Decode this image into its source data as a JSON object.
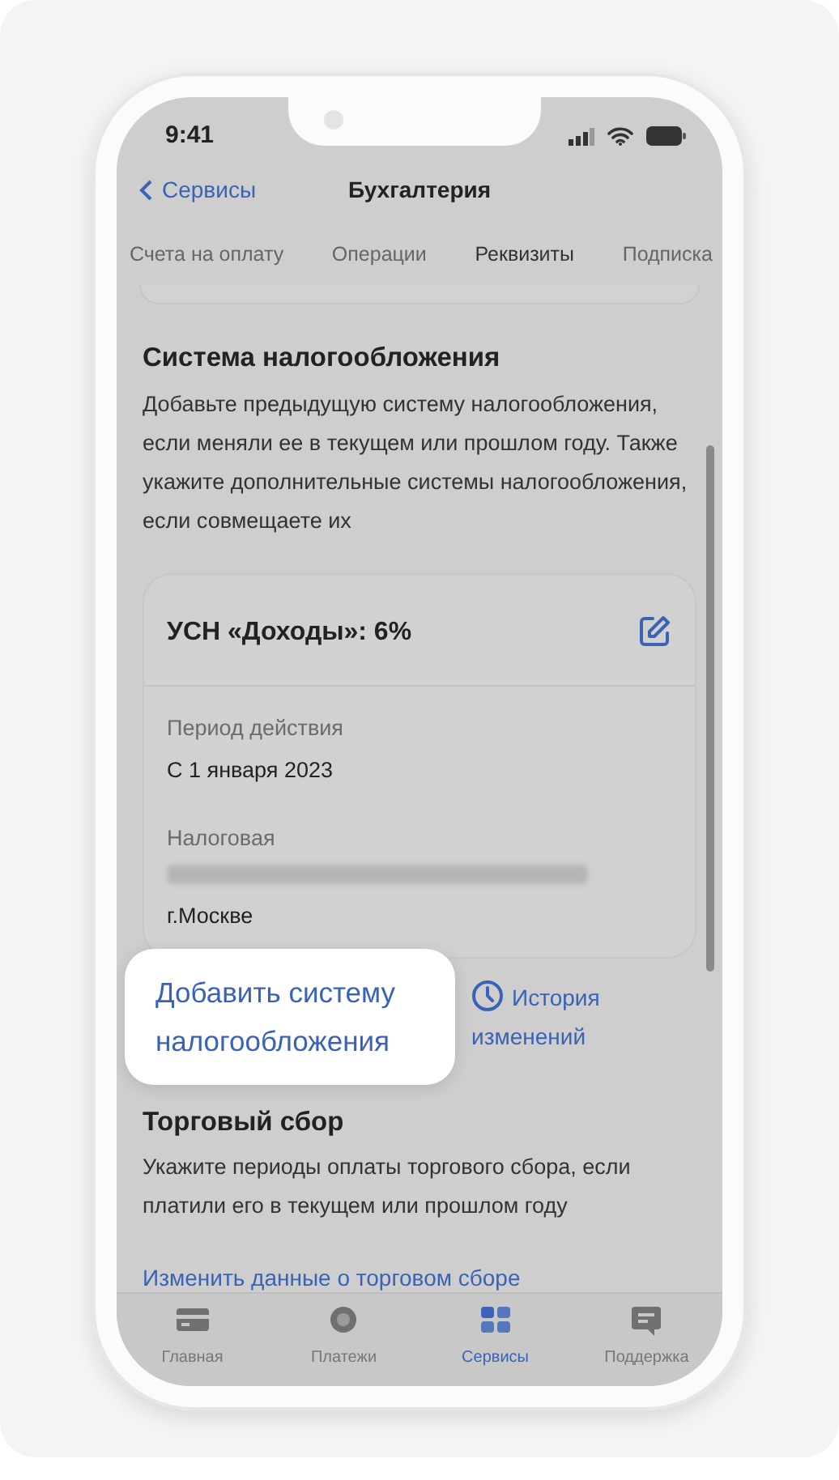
{
  "status_bar": {
    "time": "9:41"
  },
  "nav_bar": {
    "back": "Сервисы",
    "title": "Бухгалтерия"
  },
  "tabs": [
    {
      "label": "Счета на оплату",
      "selected": false
    },
    {
      "label": "Операции",
      "selected": false
    },
    {
      "label": "Реквизиты",
      "selected": true
    },
    {
      "label": "Подписка",
      "selected": false
    }
  ],
  "tax_section": {
    "title": "Система налогообложения",
    "description": "Добавьте предыдущую систему налогообложения, если меняли ее в текущем или прошлом году. Также укажите дополнительные системы налогообложения, если совмещаете их",
    "card": {
      "title": "УСН «Доходы»: 6%",
      "fields": [
        {
          "label": "Период действия",
          "value": "С 1 января 2023",
          "redacted": false
        },
        {
          "label": "Налоговая",
          "value": "г.Москве",
          "redacted": true
        }
      ]
    },
    "add_button": {
      "label": "Добавить систему налогообложения",
      "highlighted": true
    },
    "history_link": "История изменений"
  },
  "trade_fee_section": {
    "title": "Торговый сбор",
    "description": "Укажите периоды оплаты торгового сбора, если платили его в текущем или прошлом году",
    "link": "Изменить данные о торговом сборе"
  },
  "bottom_nav": [
    {
      "label": "Главная",
      "kind": "card",
      "selected": false
    },
    {
      "label": "Платежи",
      "kind": "circle",
      "selected": false
    },
    {
      "label": "Сервисы",
      "kind": "grid",
      "selected": true
    },
    {
      "label": "Поддержка",
      "kind": "chat",
      "selected": false
    }
  ]
}
